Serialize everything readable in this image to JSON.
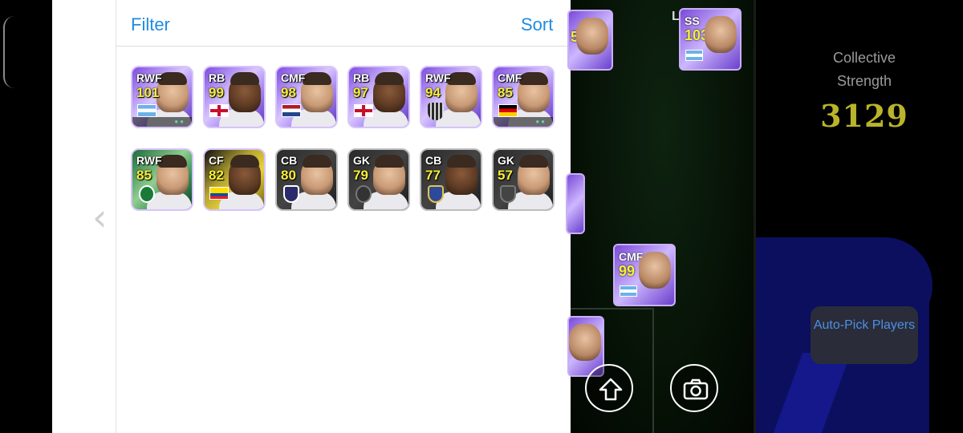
{
  "panel": {
    "filter_label": "Filter",
    "sort_label": "Sort",
    "back_glyph": "‹"
  },
  "players": [
    {
      "pos": "RWF",
      "rating": "101",
      "flag": "arg",
      "style": "epic"
    },
    {
      "pos": "RB",
      "rating": "99",
      "flag": "eng",
      "style": "epic"
    },
    {
      "pos": "CMF",
      "rating": "98",
      "flag": "ned",
      "style": "epic"
    },
    {
      "pos": "RB",
      "rating": "97",
      "flag": "eng",
      "style": "epic"
    },
    {
      "pos": "RWF",
      "rating": "94",
      "flag": "club2",
      "style": "epic"
    },
    {
      "pos": "CMF",
      "rating": "85",
      "flag": "ger",
      "style": "epic"
    },
    {
      "pos": "RWF",
      "rating": "85",
      "flag": "club3",
      "style": "green"
    },
    {
      "pos": "CF",
      "rating": "82",
      "flag": "ecu",
      "style": "yellow"
    },
    {
      "pos": "CB",
      "rating": "80",
      "flag": "club1",
      "style": "dark"
    },
    {
      "pos": "GK",
      "rating": "79",
      "flag": "club4",
      "style": "dark"
    },
    {
      "pos": "CB",
      "rating": "77",
      "flag": "club5",
      "style": "dark"
    },
    {
      "pos": "GK",
      "rating": "57",
      "flag": "club6",
      "style": "dark"
    }
  ],
  "pitch": {
    "partial_card_rating": "5",
    "ss_card": {
      "pos": "SS",
      "rating": "103"
    },
    "cmf_card": {
      "pos": "CMF",
      "rating": "99"
    },
    "corner_letter": "L"
  },
  "team": {
    "collective_label": "Collective Strength",
    "collective_value": "3129",
    "autopick_label": "Auto-Pick Players"
  },
  "icons": {
    "upload": "upload-arrow-icon",
    "camera": "camera-icon"
  }
}
